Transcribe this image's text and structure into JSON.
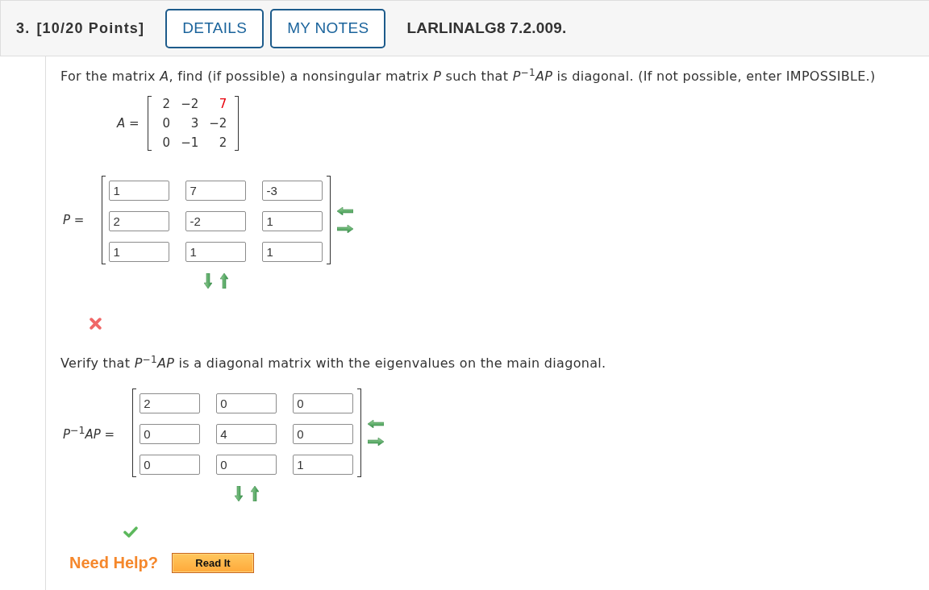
{
  "header": {
    "number": "3.",
    "points": "[10/20 Points]",
    "buttons": [
      "DETAILS",
      "MY NOTES"
    ],
    "problem_id": "LARLINALG8 7.2.009."
  },
  "question": {
    "prompt": "For the matrix *A*, find (if possible) a nonsingular matrix *P* such that *P*$^{−1}$*AP* is diagonal. (If not possible, enter IMPOSSIBLE.)",
    "matrix_a": {
      "label": "*A* =",
      "rows": [
        [
          {
            "text": "2",
            "color": "#333333"
          },
          {
            "text": "−2",
            "color": "#333333"
          },
          {
            "text": "7",
            "color": "#e8000b"
          }
        ],
        [
          {
            "text": "0",
            "color": "#333333"
          },
          {
            "text": "3",
            "color": "#333333"
          },
          {
            "text": "−2",
            "color": "#333333"
          }
        ],
        [
          {
            "text": "0",
            "color": "#333333"
          },
          {
            "text": "−1",
            "color": "#333333"
          },
          {
            "text": "2",
            "color": "#333333"
          }
        ]
      ]
    },
    "answer": {
      "label": "*P* =",
      "rows": [
        [
          "1",
          "7",
          "-3"
        ],
        [
          "2",
          "-2",
          "1"
        ],
        [
          "1",
          "1",
          "1"
        ]
      ],
      "correct": false
    }
  },
  "verify": {
    "prompt": "Verify that *P*$^{−1}$*AP* is a diagonal matrix with the eigenvalues on the main diagonal.",
    "answer": {
      "label": "*P*$^{−1}$*AP* =",
      "rows": [
        [
          "2",
          "0",
          "0"
        ],
        [
          "0",
          "4",
          "0"
        ],
        [
          "0",
          "0",
          "1"
        ]
      ],
      "correct": true
    }
  },
  "help": {
    "label": "Need Help?",
    "buttons": [
      "Read It"
    ]
  }
}
